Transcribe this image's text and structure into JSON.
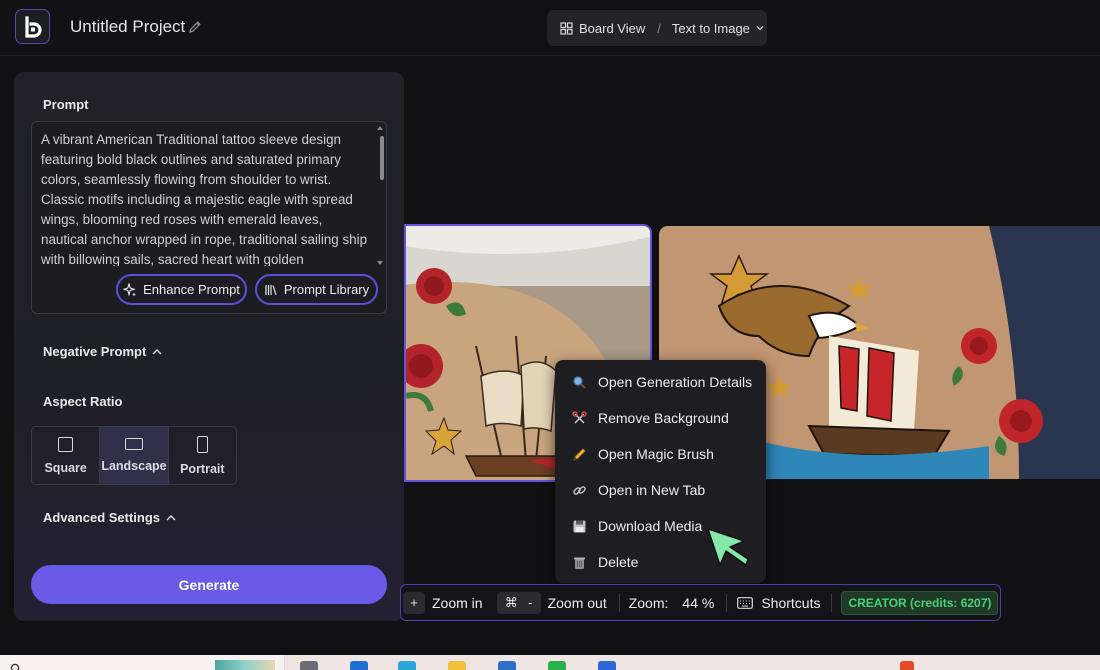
{
  "header": {
    "project_title": "Untitled Project",
    "view_label": "Board View",
    "separator": "/",
    "mode_label": "Text to Image"
  },
  "panel": {
    "prompt_label": "Prompt",
    "prompt_text": "A vibrant American Traditional tattoo sleeve design featuring bold black outlines and saturated primary colors, seamlessly flowing from shoulder to wrist. Classic motifs including a majestic eagle with spread wings, blooming red roses with emerald leaves, nautical anchor wrapped in rope, traditional sailing ship with billowing sails, sacred heart with golden",
    "enhance_label": "Enhance Prompt",
    "library_label": "Prompt Library",
    "negative_label": "Negative Prompt",
    "aspect_label": "Aspect Ratio",
    "aspect_options": [
      "Square",
      "Landscape",
      "Portrait"
    ],
    "aspect_selected": "Landscape",
    "advanced_label": "Advanced Settings",
    "generate_label": "Generate"
  },
  "context_menu": {
    "items": [
      {
        "label": "Open Generation Details",
        "icon": "magnifier-icon"
      },
      {
        "label": "Remove Background",
        "icon": "scissors-icon"
      },
      {
        "label": "Open Magic Brush",
        "icon": "pencil-icon"
      },
      {
        "label": "Open in New Tab",
        "icon": "link-icon"
      },
      {
        "label": "Download Media",
        "icon": "floppy-disk-icon"
      },
      {
        "label": "Delete",
        "icon": "trash-icon"
      }
    ]
  },
  "toolbar": {
    "zoom_in_key": "+",
    "zoom_in_label": "Zoom in",
    "zoom_out_key_mod": "⌘",
    "zoom_out_key": "-",
    "zoom_out_label": "Zoom out",
    "zoom_label": "Zoom:",
    "zoom_value": "44 %",
    "shortcuts_label": "Shortcuts",
    "credits_badge": "CREATOR (credits: 6207)"
  },
  "colors": {
    "accent": "#6a5be6",
    "accent_border": "#5c4fd6",
    "credits_green": "#49d17a"
  }
}
